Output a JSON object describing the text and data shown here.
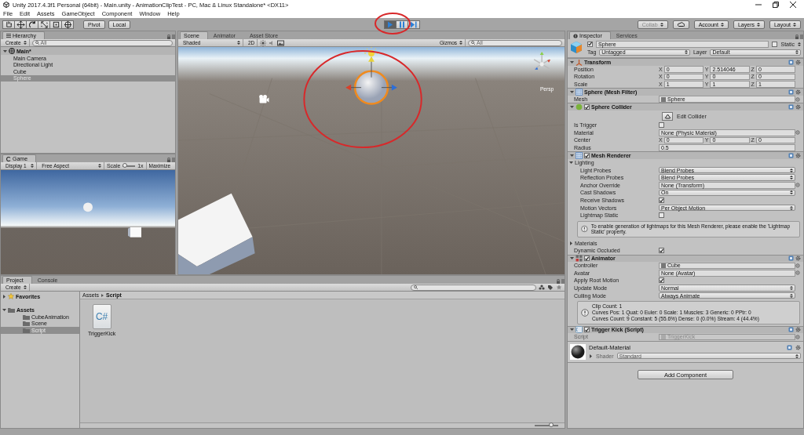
{
  "window": {
    "title": "Unity 2017.4.3f1 Personal (64bit) - Main.unity - AnimationClipTest - PC, Mac & Linux Standalone* <DX11>"
  },
  "menu": [
    "File",
    "Edit",
    "Assets",
    "GameObject",
    "Component",
    "Window",
    "Help"
  ],
  "toolbar": {
    "tools": [
      {
        "kind": "hand"
      },
      {
        "kind": "move"
      },
      {
        "kind": "rotate"
      },
      {
        "kind": "scale"
      },
      {
        "kind": "rect"
      },
      {
        "kind": "transform"
      }
    ],
    "pivot": "Pivot",
    "local": "Local",
    "playback": [
      {
        "kind": "play",
        "selected": true
      },
      {
        "kind": "pause",
        "selected": false
      },
      {
        "kind": "step",
        "selected": false
      }
    ],
    "menus": [
      {
        "label": "Collab",
        "disabled": true
      },
      {
        "label": "Account",
        "disabled": false
      },
      {
        "label": "Layers",
        "disabled": false
      },
      {
        "label": "Layout",
        "disabled": false
      }
    ]
  },
  "hierarchy": {
    "tab": "Hierarchy",
    "create": "Create",
    "search_placeholder": "All",
    "scene": "Main*",
    "items": [
      {
        "label": "Main Camera",
        "selected": false
      },
      {
        "label": "Directional Light",
        "selected": false
      },
      {
        "label": "Cube",
        "selected": false
      },
      {
        "label": "Sphere",
        "selected": true
      }
    ]
  },
  "game": {
    "tab": "Game",
    "display": "Display 1",
    "aspect": "Free Aspect",
    "scale": {
      "label": "Scale",
      "level": 0.15,
      "value": "1x"
    },
    "maximize": "Maximize"
  },
  "scene": {
    "tabs": [
      {
        "label": "Scene",
        "selected": true
      },
      {
        "label": "Animator",
        "selected": false
      },
      {
        "label": "Asset Store",
        "selected": false
      }
    ],
    "shading": "Shaded",
    "mode_2d": "2D",
    "gizmos": "Gizmos",
    "search_placeholder": "All",
    "projection": "Persp"
  },
  "project": {
    "tabs": [
      {
        "label": "Project",
        "selected": true
      },
      {
        "label": "Console",
        "selected": false
      }
    ],
    "create": "Create",
    "tree": [
      {
        "kind": "favorites",
        "label": "Favorites",
        "expanded": false,
        "selected": false
      },
      {
        "kind": "folder",
        "label": "Assets",
        "expanded": true,
        "selected": false,
        "children": [
          {
            "kind": "folder",
            "label": "CubeAnimation",
            "selected": false
          },
          {
            "kind": "folder",
            "label": "Scene",
            "selected": false
          },
          {
            "kind": "folder",
            "label": "Script",
            "selected": true
          }
        ]
      }
    ],
    "breadcrumb": [
      "Assets",
      "Script"
    ],
    "icon_size": {
      "level": 0.7
    },
    "files": [
      {
        "name": "TriggerKick",
        "badge": "C#"
      }
    ]
  },
  "inspector": {
    "tabs": [
      {
        "label": "Inspector",
        "selected": true
      },
      {
        "label": "Services",
        "selected": false
      }
    ],
    "object": {
      "active": true,
      "name": "Sphere",
      "static_label": "Static",
      "static": false,
      "tag_label": "Tag",
      "tag": "Untagged",
      "layer_label": "Layer",
      "layer": "Default"
    },
    "components": [
      {
        "kind": "transform",
        "title": "Transform",
        "expanded": true,
        "rows": [
          {
            "kind": "vector",
            "label": "Position",
            "fields": [
              {
                "axis": "X",
                "value": "0"
              },
              {
                "axis": "Y",
                "value": "2.514046"
              },
              {
                "axis": "Z",
                "value": "0"
              }
            ]
          },
          {
            "kind": "vector",
            "label": "Rotation",
            "fields": [
              {
                "axis": "X",
                "value": "0"
              },
              {
                "axis": "Y",
                "value": "0"
              },
              {
                "axis": "Z",
                "value": "0"
              }
            ]
          },
          {
            "kind": "vector",
            "label": "Scale",
            "fields": [
              {
                "axis": "X",
                "value": "1"
              },
              {
                "axis": "Y",
                "value": "1"
              },
              {
                "axis": "Z",
                "value": "1"
              }
            ]
          }
        ]
      },
      {
        "kind": "mesh_filter",
        "title": "Sphere (Mesh Filter)",
        "expanded": true,
        "rows": [
          {
            "kind": "object",
            "label": "Mesh",
            "value": "Sphere",
            "asset": true
          }
        ]
      },
      {
        "kind": "collider",
        "title": "Sphere Collider",
        "enabled": true,
        "expanded": true,
        "rows": [
          {
            "kind": "button",
            "label": "Edit Collider"
          },
          {
            "kind": "checkbox",
            "label": "Is Trigger",
            "checked": false
          },
          {
            "kind": "object",
            "label": "Material",
            "value": "None (Physic Material)",
            "asset": false
          },
          {
            "kind": "vector",
            "label": "Center",
            "fields": [
              {
                "axis": "X",
                "value": "0"
              },
              {
                "axis": "Y",
                "value": "0"
              },
              {
                "axis": "Z",
                "value": "0"
              }
            ]
          },
          {
            "kind": "text",
            "label": "Radius",
            "value": "0.5"
          }
        ]
      },
      {
        "kind": "renderer",
        "title": "Mesh Renderer",
        "enabled": true,
        "expanded": true,
        "rows": [
          {
            "kind": "foldout",
            "label": "Lighting",
            "expanded": true,
            "children": [
              {
                "kind": "dropdown",
                "label": "Light Probes",
                "value": "Blend Probes"
              },
              {
                "kind": "dropdown",
                "label": "Reflection Probes",
                "value": "Blend Probes"
              },
              {
                "kind": "object",
                "label": "Anchor Override",
                "value": "None (Transform)",
                "asset": false
              },
              {
                "kind": "dropdown",
                "label": "Cast Shadows",
                "value": "On"
              },
              {
                "kind": "checkbox",
                "label": "Receive Shadows",
                "checked": true
              },
              {
                "kind": "dropdown",
                "label": "Motion Vectors",
                "value": "Per Object Motion"
              },
              {
                "kind": "checkbox",
                "label": "Lightmap Static",
                "checked": false
              },
              {
                "kind": "note",
                "text": "To enable generation of lightmaps for this Mesh Renderer, please enable the 'Lightmap Static' property."
              }
            ]
          },
          {
            "kind": "foldout",
            "label": "Materials",
            "expanded": false
          },
          {
            "kind": "checkbox",
            "label": "Dynamic Occluded",
            "checked": true
          }
        ]
      },
      {
        "kind": "animator",
        "title": "Animator",
        "enabled": true,
        "expanded": true,
        "rows": [
          {
            "kind": "object",
            "label": "Controller",
            "value": "Cube",
            "asset": true
          },
          {
            "kind": "object",
            "label": "Avatar",
            "value": "None (Avatar)",
            "asset": false
          },
          {
            "kind": "checkbox",
            "label": "Apply Root Motion",
            "checked": true
          },
          {
            "kind": "dropdown",
            "label": "Update Mode",
            "value": "Normal"
          },
          {
            "kind": "dropdown",
            "label": "Culling Mode",
            "value": "Always Animate"
          },
          {
            "kind": "note",
            "text": "Clip Count: 1\nCurves Pos: 1 Quat: 0 Euler: 0 Scale: 1 Muscles: 3 Generic: 0 PPtr: 0\nCurves Count: 9 Constant: 5 (55.6%) Dense: 0 (0.0%) Stream: 4 (44.4%)"
          }
        ]
      },
      {
        "kind": "script",
        "title": "Trigger Kick (Script)",
        "enabled": true,
        "expanded": true,
        "rows": [
          {
            "kind": "object",
            "label": "Script",
            "value": "TriggerKick",
            "asset": true,
            "disabled": true
          }
        ]
      },
      {
        "kind": "material",
        "title": "Default-Material",
        "expanded": false,
        "shader_label": "Shader",
        "shader": "Standard"
      }
    ],
    "add_component": "Add Component"
  }
}
